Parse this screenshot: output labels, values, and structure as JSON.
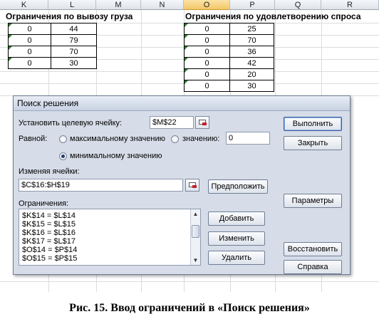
{
  "columns": [
    "K",
    "L",
    "M",
    "N",
    "O",
    "P",
    "Q",
    "R"
  ],
  "selected_column": "O",
  "export_table": {
    "title": "Ограничения по вывозу груза",
    "rows": [
      [
        "0",
        "44"
      ],
      [
        "0",
        "79"
      ],
      [
        "0",
        "70"
      ],
      [
        "0",
        "30"
      ]
    ]
  },
  "demand_table": {
    "title": "Ограничения по удовлетворению спроса",
    "rows": [
      [
        "0",
        "25"
      ],
      [
        "0",
        "70"
      ],
      [
        "0",
        "36"
      ],
      [
        "0",
        "42"
      ],
      [
        "0",
        "20"
      ],
      [
        "0",
        "30"
      ]
    ]
  },
  "dialog": {
    "title": "Поиск решения",
    "target_label": "Установить целевую ячейку:",
    "target_value": "$M$22",
    "equal_label": "Равной:",
    "max_label": "максимальному значению",
    "value_label": "значению:",
    "value_input": "0",
    "min_label": "минимальному значению",
    "changing_label": "Изменяя ячейки:",
    "changing_value": "$C$16:$H$19",
    "constraints_label": "Ограничения:",
    "constraints": [
      "$K$14 = $L$14",
      "$K$15 = $L$15",
      "$K$16 = $L$16",
      "$K$17 = $L$17",
      "$O$14 = $P$14",
      "$O$15 = $P$15"
    ],
    "buttons": {
      "execute": "Выполнить",
      "close": "Закрыть",
      "guess": "Предположить",
      "parameters": "Параметры",
      "add": "Добавить",
      "change": "Изменить",
      "restore": "Восстановить",
      "delete": "Удалить",
      "help": "Справка"
    }
  },
  "caption": "Рис. 15. Ввод ограничений в «Поиск решения»"
}
